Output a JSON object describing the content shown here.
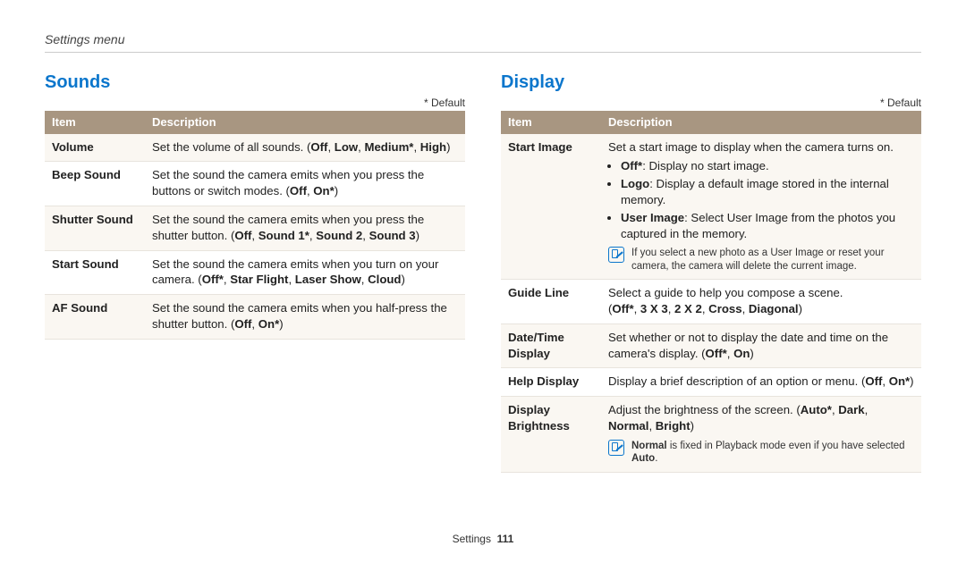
{
  "breadcrumb": "Settings menu",
  "default_marker": "* Default",
  "header_item": "Item",
  "header_desc": "Description",
  "footer_section": "Settings",
  "footer_page": "111",
  "sounds": {
    "title": "Sounds",
    "rows": {
      "volume": {
        "item": "Volume",
        "pre": "Set the volume of all sounds. (",
        "b1": "Off",
        "s1": ", ",
        "b2": "Low",
        "s2": ", ",
        "b3": "Medium*",
        "s3": ", ",
        "b4": "High",
        "post": ")"
      },
      "beep": {
        "item": "Beep Sound",
        "pre": "Set the sound the camera emits when you press the buttons or switch modes. (",
        "b1": "Off",
        "s1": ", ",
        "b2": "On*",
        "post": ")"
      },
      "shutter": {
        "item": "Shutter Sound",
        "pre": "Set the sound the camera emits when you press the shutter button. (",
        "b1": "Off",
        "s1": ", ",
        "b2": "Sound 1*",
        "s2": ", ",
        "b3": "Sound 2",
        "s3": ", ",
        "b4": "Sound 3",
        "post": ")"
      },
      "start": {
        "item": "Start Sound",
        "pre": "Set the sound the camera emits when you turn on your camera. (",
        "b1": "Off*",
        "s1": ", ",
        "b2": "Star Flight",
        "s2": ", ",
        "b3": "Laser Show",
        "s3": ", ",
        "b4": "Cloud",
        "post": ")"
      },
      "af": {
        "item": "AF Sound",
        "pre": "Set the sound the camera emits when you half-press the shutter button. (",
        "b1": "Off",
        "s1": ", ",
        "b2": "On*",
        "post": ")"
      }
    }
  },
  "display": {
    "title": "Display",
    "rows": {
      "start_image": {
        "item": "Start Image",
        "lead": "Set a start image to display when the camera turns on.",
        "opt_off_b": "Off*",
        "opt_off_t": ": Display no start image.",
        "opt_logo_b": "Logo",
        "opt_logo_t": ": Display a default image stored in the internal memory.",
        "opt_user_b": "User Image",
        "opt_user_t": ": Select User Image from the photos you captured in the memory.",
        "note": "If you select a new photo as a User Image or reset your camera, the camera will delete the current image."
      },
      "guide_line": {
        "item": "Guide Line",
        "pre": "Select a guide to help you compose a scene.\n(",
        "b1": "Off*",
        "s1": ", ",
        "b2": "3 X 3",
        "s2": ", ",
        "b3": "2 X 2",
        "s3": ", ",
        "b4": "Cross",
        "s4": ", ",
        "b5": "Diagonal",
        "post": ")"
      },
      "datetime": {
        "item": "Date/Time Display",
        "pre": "Set whether or not to display the date and time on the camera's display. (",
        "b1": "Off*",
        "s1": ", ",
        "b2": "On",
        "post": ")"
      },
      "help": {
        "item": "Help Display",
        "pre": "Display a brief description of an option or menu. (",
        "b1": "Off",
        "s1": ", ",
        "b2": "On*",
        "post": ")"
      },
      "brightness": {
        "item": "Display Brightness",
        "pre": "Adjust the brightness of the screen. (",
        "b1": "Auto*",
        "s1": ", ",
        "b2": "Dark",
        "s2": ", ",
        "b3": "Normal",
        "s3": ", ",
        "b4": "Bright",
        "post": ")",
        "note_b1": "Normal",
        "note_t1": " is fixed in Playback mode even if you have selected ",
        "note_b2": "Auto",
        "note_t2": "."
      }
    }
  }
}
